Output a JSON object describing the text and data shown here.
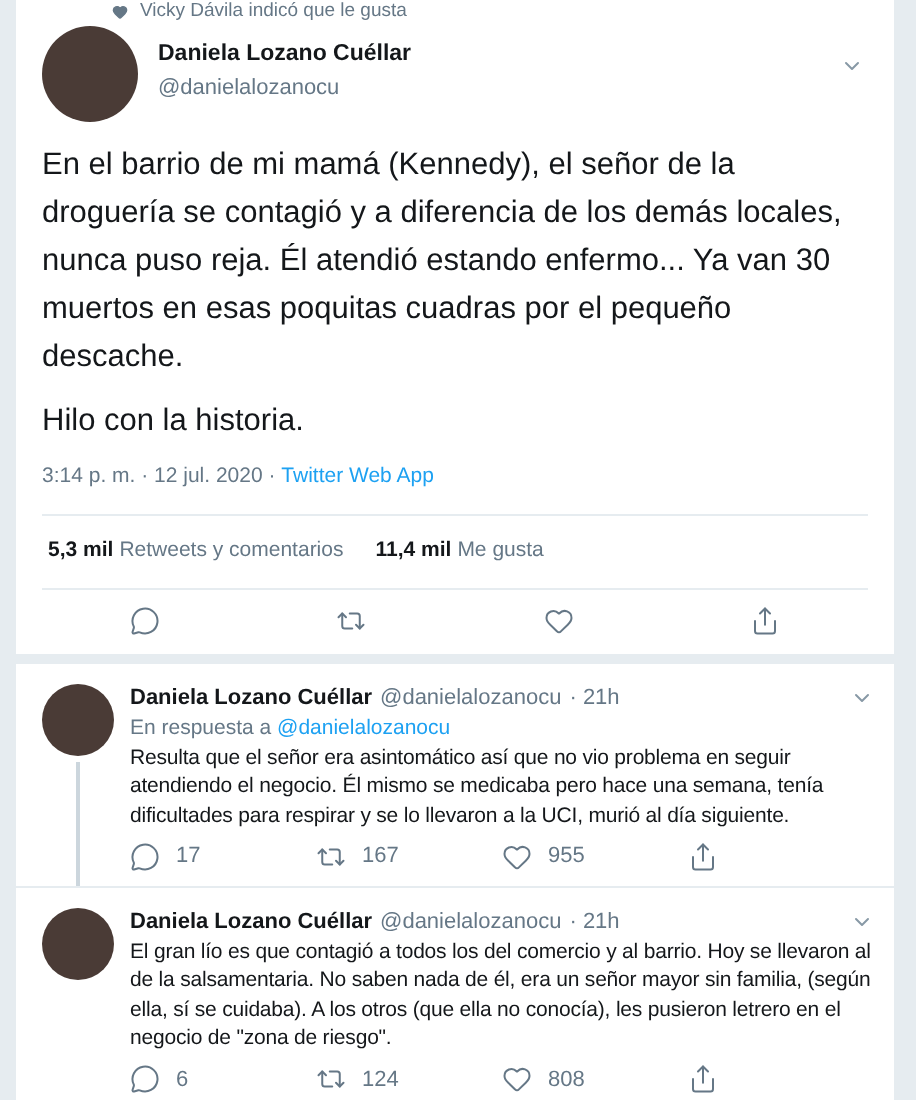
{
  "social_context": "Vicky Dávila indicó que le gusta",
  "main_tweet": {
    "name": "Daniela Lozano Cuéllar",
    "handle": "@danielalozanocu",
    "paragraphs": [
      "En el barrio de mi mamá (Kennedy), el señor de la droguería se contagió y a diferencia de los demás locales, nunca puso reja. Él atendió estando enfermo... Ya van 30 muertos en esas poquitas cuadras por el pequeño descache.",
      "Hilo con la historia."
    ],
    "timestamp": "3:14 p. m. · 12 jul. 2020 · ",
    "source": "Twitter Web App",
    "stats": [
      {
        "count": "5,3 mil",
        "label": "Retweets y comentarios"
      },
      {
        "count": "11,4 mil",
        "label": "Me gusta"
      }
    ]
  },
  "replies": [
    {
      "name": "Daniela Lozano Cuéllar",
      "handle": "@danielalozanocu",
      "time": "· 21h",
      "in_reply_to": {
        "label": "En respuesta a ",
        "handle": "@danielalozanocu"
      },
      "text": "Resulta que el señor era asintomático así que no vio problema en seguir atendiendo el negocio. Él mismo se medicaba pero hace una semana, tenía dificultades para respirar y se lo llevaron a la UCI, murió al día siguiente.",
      "replies": "17",
      "retweets": "167",
      "likes": "955"
    },
    {
      "name": "Daniela Lozano Cuéllar",
      "handle": "@danielalozanocu",
      "time": "· 21h",
      "text": "El gran lío es que contagió a todos los del comercio y al barrio. Hoy se llevaron al de la salsamentaria. No saben nada de él, era un señor mayor sin familia, (según ella, sí se cuidaba). A los otros (que ella no conocía), les pusieron letrero en el negocio de \"zona de riesgo\".",
      "replies": "6",
      "retweets": "124",
      "likes": "808"
    }
  ]
}
